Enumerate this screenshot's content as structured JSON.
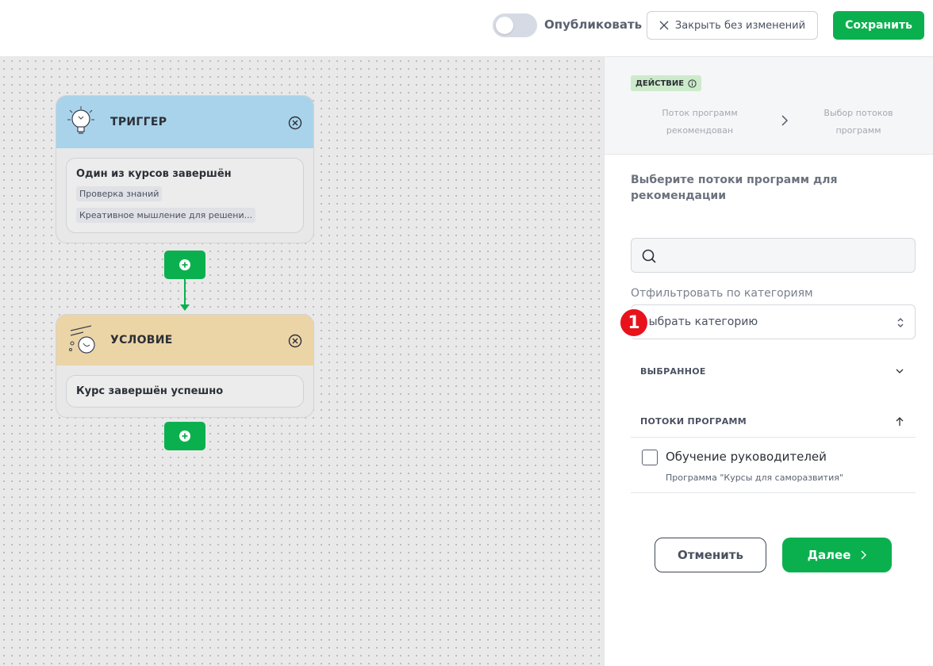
{
  "topbar": {
    "publish_label": "Опубликовать",
    "close_label": "Закрыть без изменений",
    "save_label": "Сохранить"
  },
  "canvas": {
    "trigger": {
      "title": "ТРИГГЕР",
      "card_title": "Один из курсов завершён",
      "tags": [
        "Проверка знаний",
        "Креативное мышление для решени..."
      ]
    },
    "condition": {
      "title": "УСЛОВИЕ",
      "card_title": "Курс завершён успешно"
    }
  },
  "panel": {
    "badge": "ДЕЙСТВИЕ",
    "steps": [
      "Поток программ рекомендован",
      "Выбор потоков программ"
    ],
    "subtitle": "Выберите потоки программ для рекомендации",
    "search": {
      "value": "",
      "placeholder": ""
    },
    "filter_label": "Отфильтровать по категориям",
    "select_value": "Выбрать категорию",
    "marker": "1",
    "section_favorite": "ВЫБРАННОЕ",
    "section_streams": "ПОТОКИ ПРОГРАММ",
    "program": {
      "title": "Обучение руководителей",
      "subtitle": "Программа \"Курсы для саморазвития\""
    },
    "cancel_label": "Отменить",
    "next_label": "Далее"
  },
  "colors": {
    "accent": "#0bb04e",
    "trigger_header": "#a9d3ea",
    "condition_header": "#ebd4a6",
    "badge": "#cdebcb",
    "marker": "#e8121b"
  }
}
